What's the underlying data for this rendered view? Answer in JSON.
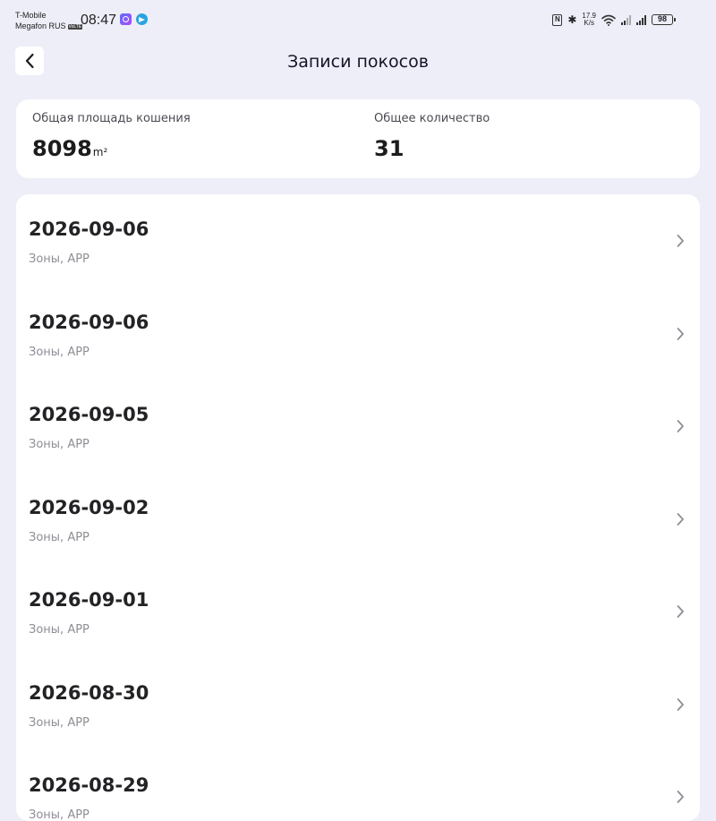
{
  "status_bar": {
    "carrier_1": "T-Mobile",
    "carrier_2": "Megafon RUS",
    "volte_badge": "VoLTE",
    "time": "08:47",
    "net_speed_value": "17.9",
    "net_speed_unit": "K/s",
    "battery": "98",
    "icons": [
      "app-notification-icon",
      "telegram-icon",
      "nfc-icon",
      "bluetooth-icon",
      "wifi-icon",
      "signal-icon",
      "battery-icon"
    ]
  },
  "header": {
    "title": "Записи покосов",
    "back_icon": "chevron-left-icon"
  },
  "summary": {
    "area_label": "Общая площадь кошения",
    "area_value": "8098",
    "area_unit": "m²",
    "count_label": "Общее количество",
    "count_value": "31"
  },
  "records": [
    {
      "date": "2026-09-06",
      "subtitle": "Зоны, APP"
    },
    {
      "date": "2026-09-06",
      "subtitle": "Зоны, APP"
    },
    {
      "date": "2026-09-05",
      "subtitle": "Зоны, APP"
    },
    {
      "date": "2026-09-02",
      "subtitle": "Зоны, APP"
    },
    {
      "date": "2026-09-01",
      "subtitle": "Зоны, APP"
    },
    {
      "date": "2026-08-30",
      "subtitle": "Зоны, APP"
    },
    {
      "date": "2026-08-29",
      "subtitle": "Зоны, APP"
    }
  ],
  "colors": {
    "background": "#eeeef8",
    "card": "#ffffff",
    "title": "#141428",
    "primary_text": "#232326",
    "secondary_text": "#8e8e96"
  }
}
